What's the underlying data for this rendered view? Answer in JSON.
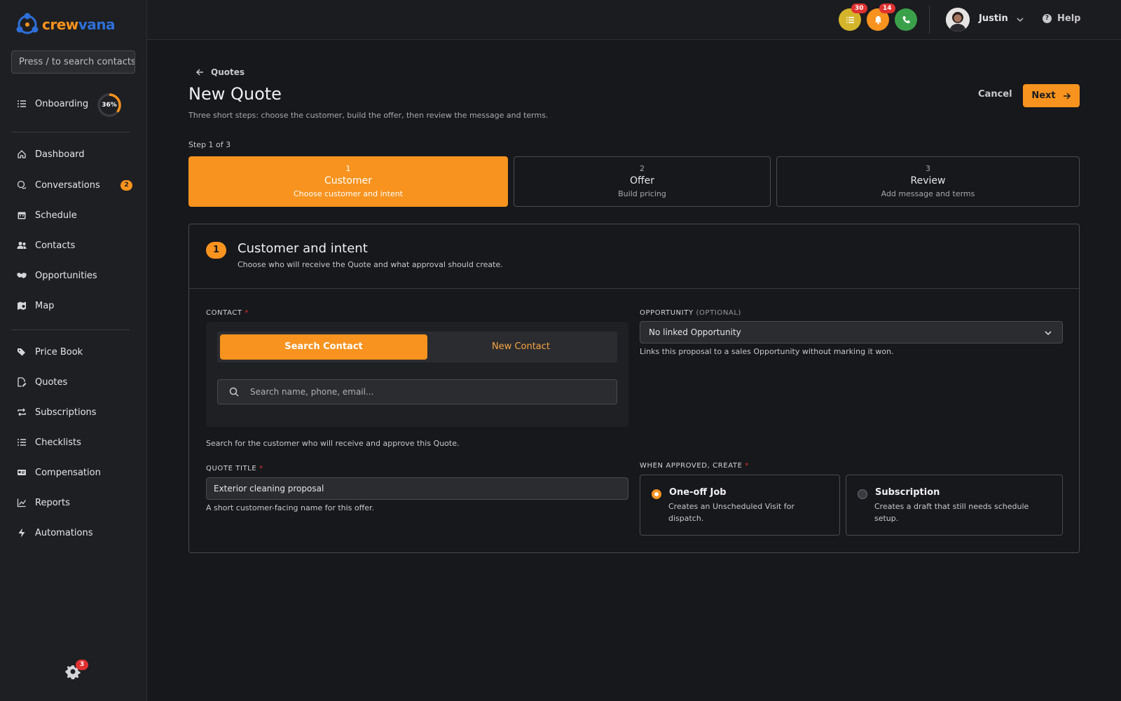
{
  "brand": {
    "part1": "crew",
    "part2": "vana"
  },
  "sidebar": {
    "search_placeholder": "Press / to search contacts",
    "onboarding": {
      "label": "Onboarding",
      "progress": 0.36,
      "progress_label": "36%"
    },
    "items": [
      {
        "label": "Dashboard",
        "icon": "home-icon"
      },
      {
        "label": "Conversations",
        "icon": "chat-icon",
        "badge": "2"
      },
      {
        "label": "Schedule",
        "icon": "calendar-icon"
      },
      {
        "label": "Contacts",
        "icon": "users-icon"
      },
      {
        "label": "Opportunities",
        "icon": "handshake-icon"
      },
      {
        "label": "Map",
        "icon": "map-icon"
      },
      {
        "label": "Price Book",
        "icon": "tags-icon"
      },
      {
        "label": "Quotes",
        "icon": "quote-icon"
      },
      {
        "label": "Subscriptions",
        "icon": "repeat-icon"
      },
      {
        "label": "Checklists",
        "icon": "checklist-icon"
      },
      {
        "label": "Compensation",
        "icon": "id-card-icon"
      },
      {
        "label": "Reports",
        "icon": "chart-line-icon"
      },
      {
        "label": "Automations",
        "icon": "bolt-icon"
      }
    ],
    "settings_badge": "3"
  },
  "topbar": {
    "tasks_badge": "30",
    "notifications_badge": "14",
    "user_name": "Justin",
    "help_label": "Help",
    "colors": {
      "tasks": "#d4b42a",
      "notifications": "#f7931e",
      "phone": "#3aa14a"
    }
  },
  "page": {
    "back_label": "Quotes",
    "title": "New Quote",
    "subtitle": "Three short steps: choose the customer, build the offer, then review the message and terms.",
    "cancel_label": "Cancel",
    "next_label": "Next",
    "step_indicator": "Step 1 of 3",
    "steps": [
      {
        "num": "1",
        "name": "Customer",
        "desc": "Choose customer and intent",
        "active": true
      },
      {
        "num": "2",
        "name": "Offer",
        "desc": "Build pricing",
        "active": false
      },
      {
        "num": "3",
        "name": "Review",
        "desc": "Add message and terms",
        "active": false
      }
    ]
  },
  "panel": {
    "num": "1",
    "title": "Customer and intent",
    "subtitle": "Choose who will receive the Quote and what approval should create.",
    "contact": {
      "label": "CONTACT",
      "required": "*",
      "tab_search": "Search Contact",
      "tab_new": "New Contact",
      "search_placeholder": "Search name, phone, email...",
      "help": "Search for the customer who will receive and approve this Quote."
    },
    "opportunity": {
      "label": "OPPORTUNITY",
      "optional": "(OPTIONAL)",
      "value": "No linked Opportunity",
      "help": "Links this proposal to a sales Opportunity without marking it won."
    },
    "quote_title": {
      "label": "QUOTE TITLE",
      "required": "*",
      "value": "Exterior cleaning proposal",
      "help": "A short customer-facing name for this offer."
    },
    "when_approved": {
      "label": "WHEN APPROVED, CREATE",
      "required": "*",
      "options": [
        {
          "title": "One-off Job",
          "desc": "Creates an Unscheduled Visit for dispatch.",
          "selected": true
        },
        {
          "title": "Subscription",
          "desc": "Creates a draft that still needs schedule setup.",
          "selected": false
        }
      ]
    }
  },
  "accent_color": "#f7931e"
}
